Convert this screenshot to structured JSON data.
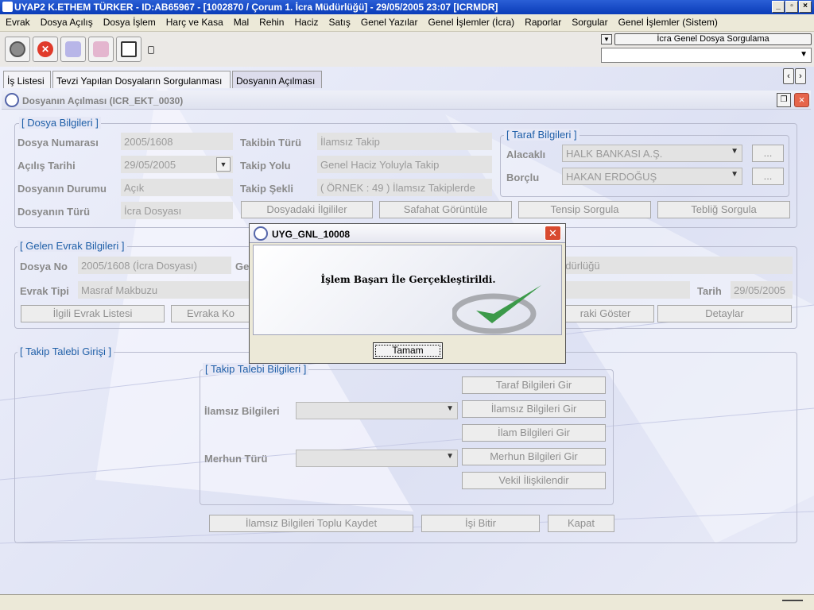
{
  "window": {
    "title": "UYAP2  K.ETHEM TÜRKER - ID:AB65967 - [1002870 / Çorum 1. İcra Müdürlüğü] - 29/05/2005 23:07 [ICRMDR]"
  },
  "menu": [
    "Evrak",
    "Dosya Açılış",
    "Dosya İşlem",
    "Harç ve Kasa",
    "Mal",
    "Rehin",
    "Haciz",
    "Satış",
    "Genel Yazılar",
    "Genel İşlemler (İcra)",
    "Raporlar",
    "Sorgular",
    "Genel İşlemler (Sistem)"
  ],
  "toolbar": {
    "query_label": "İcra Genel Dosya Sorgulama",
    "query_select": ""
  },
  "tabs": [
    "İş Listesi",
    "Tevzi Yapılan Dosyaların Sorgulanması",
    "Dosyanın Açılması"
  ],
  "panel": {
    "title": "Dosyanın Açılması (ICR_EKT_0030)"
  },
  "dosya": {
    "group": "[ Dosya Bilgileri ]",
    "no_label": "Dosya Numarası",
    "no_value": "2005/1608",
    "tarih_label": "Açılış Tarihi",
    "tarih_value": "29/05/2005",
    "durum_label": "Dosyanın Durumu",
    "durum_value": "Açık",
    "tur_label": "Dosyanın Türü",
    "tur_value": "İcra Dosyası",
    "takibin_turu_label": "Takibin Türü",
    "takibin_turu_value": "İlamsız Takip",
    "takip_yolu_label": "Takip Yolu",
    "takip_yolu_value": "Genel Haciz Yoluyla Takip",
    "takip_sekli_label": "Takip Şekli",
    "takip_sekli_value": "( ÖRNEK  : 49 ) İlamsız Takiplerde",
    "btn_ilgililer": "Dosyadaki İlgililer",
    "btn_safahat": "Safahat Görüntüle",
    "btn_tensip": "Tensip Sorgula",
    "btn_teblig": "Tebliğ Sorgula"
  },
  "taraf": {
    "group": "[ Taraf Bilgileri ]",
    "alacakli_label": "Alacaklı",
    "alacakli_value": "HALK BANKASI A.Ş.",
    "borclu_label": "Borçlu",
    "borclu_value": "HAKAN ERDOĞUŞ",
    "more": "..."
  },
  "evrak": {
    "group": "[ Gelen Evrak Bilgileri ]",
    "dosya_no_label": "Dosya No",
    "dosya_no_value": "2005/1608 (İcra Dosyası)",
    "ge_label": "Ge",
    "mudurluk_value": "üdürlüğü",
    "tipi_label": "Evrak Tipi",
    "tipi_value": "Masraf Makbuzu",
    "tarih_label": "Tarih",
    "tarih_value": "29/05/2005",
    "btn_ilgili": "İlgili Evrak Listesi",
    "btn_evraka": "Evraka Ko",
    "btn_goster": "raki Göster",
    "btn_detaylar": "Detaylar"
  },
  "takip": {
    "group": "[ Takip Talebi Girişi ]",
    "subgroup": "[ Takip Talebi Bilgileri ]",
    "ilamsiz_label": "İlamsız Bilgileri",
    "merhun_label": "Merhun Türü",
    "btn_taraf": "Taraf Bilgileri Gir",
    "btn_ilamsiz": "İlamsız Bilgileri Gir",
    "btn_ilam": "İlam Bilgileri Gir",
    "btn_merhun": "Merhun Bilgileri Gir",
    "btn_vekil": "Vekil İlişkilendir",
    "btn_toplu": "İlamsız Bilgileri Toplu Kaydet",
    "btn_isibitir": "İşi Bitir",
    "btn_kapat": "Kapat"
  },
  "dialog": {
    "title": "UYG_GNL_10008",
    "message": "İşlem Başarı İle Gerçekleştirildi.",
    "ok": "Tamam"
  }
}
